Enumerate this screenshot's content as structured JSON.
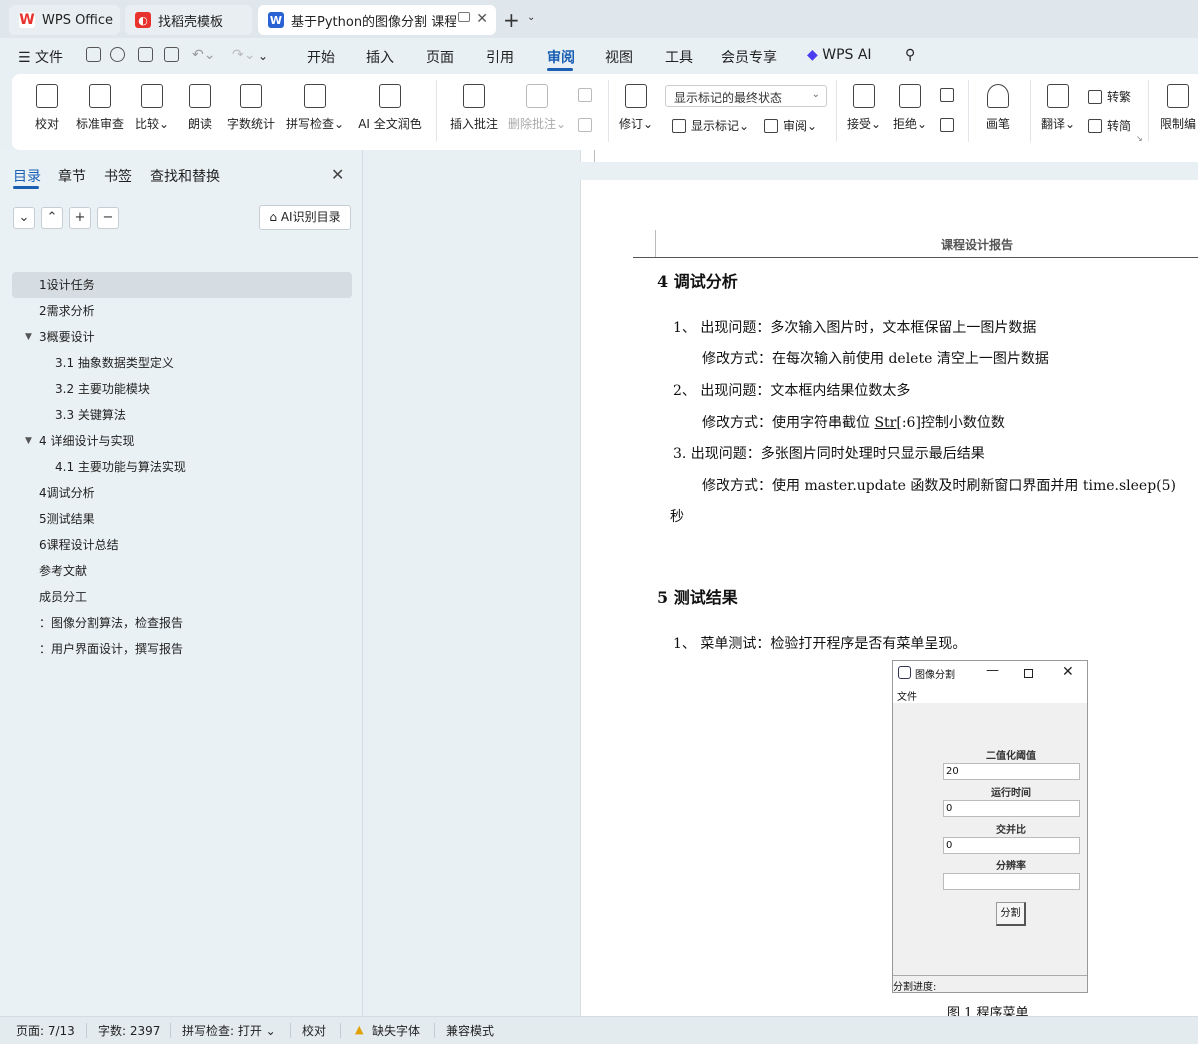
{
  "tabs": [
    {
      "label": "WPS Office",
      "icon": "wps-logo-icon",
      "color": "#e8322d"
    },
    {
      "label": "找稻壳模板",
      "icon": "docer-icon",
      "color": "#e8322d"
    },
    {
      "label": "基于Python的图像分割 课程",
      "icon": "writer-icon",
      "color": "#2a62d6"
    }
  ],
  "menu": {
    "file": "文件",
    "items": [
      "开始",
      "插入",
      "页面",
      "引用",
      "审阅",
      "视图",
      "工具",
      "会员专享"
    ],
    "active": "审阅",
    "wps_ai": "WPS AI"
  },
  "ribbon": {
    "proofread": "校对",
    "standard_review": "标准审查",
    "compare": "比较",
    "read_aloud": "朗读",
    "word_count": "字数统计",
    "spell_check": "拼写检查",
    "ai_polish": "AI 全文润色",
    "insert_comment": "插入批注",
    "delete_comment": "删除批注",
    "track_changes": "修订",
    "markup_select": "显示标记的最终状态",
    "show_markup": "显示标记",
    "review": "审阅",
    "accept": "接受",
    "reject": "拒绝",
    "pen": "画笔",
    "translate": "翻译",
    "to_traditional": "转繁",
    "to_simplified": "转简",
    "restrict_edit": "限制编"
  },
  "nav": {
    "tabs": [
      "目录",
      "章节",
      "书签",
      "查找和替换"
    ],
    "active_tab": "目录",
    "ai_toc": "AI识别目录",
    "toc": [
      {
        "label": "1设计任务",
        "level": 1,
        "active": true
      },
      {
        "label": "2需求分析",
        "level": 1
      },
      {
        "label": "3概要设计",
        "level": 1,
        "expanded": true
      },
      {
        "label": "3.1 抽象数据类型定义",
        "level": 2
      },
      {
        "label": "3.2  主要功能模块",
        "level": 2
      },
      {
        "label": "3.3  关键算法",
        "level": 2
      },
      {
        "label": "4    详细设计与实现",
        "level": 1,
        "expanded": true
      },
      {
        "label": "4.1  主要功能与算法实现",
        "level": 2
      },
      {
        "label": "4调试分析",
        "level": 1
      },
      {
        "label": "5测试结果",
        "level": 1
      },
      {
        "label": "6课程设计总结",
        "level": 1
      },
      {
        "label": "参考文献",
        "level": 1
      },
      {
        "label": "成员分工",
        "level": 1
      },
      {
        "label": "：图像分割算法，检查报告",
        "level": 1
      },
      {
        "label": "：用户界面设计，撰写报告",
        "level": 1
      }
    ]
  },
  "doc": {
    "running_header": "课程设计报告",
    "section4_title": "4   调试分析",
    "p1": "1、  出现问题：多次输入图片时，文本框保留上一图片数据",
    "p2": "修改方式：在每次输入前使用 delete 清空上一图片数据",
    "p3": "2、  出现问题：文本框内结果位数太多",
    "p4_a": "修改方式：使用字符串截位 ",
    "p4_u": "Str",
    "p4_b": "[:6]控制小数位数",
    "p5": "3.    出现问题：多张图片同时处理时只显示最后结果",
    "p6": "修改方式：使用 master.update  函数及时刷新窗口界面并用 time.sleep(5)",
    "p7": "秒",
    "section5_title": "5   测试结果",
    "p8": "1、  菜单测试：检验打开程序是否有菜单呈现。",
    "caption": "图 1  程序菜单"
  },
  "app": {
    "title": "图像分割",
    "menu_file": "文件",
    "fields": [
      {
        "label": "二值化阈值",
        "value": "20"
      },
      {
        "label": "运行时间",
        "value": "0"
      },
      {
        "label": "交并比",
        "value": "0"
      },
      {
        "label": "分辨率",
        "value": ""
      }
    ],
    "button": "分割",
    "status": "分割进度:"
  },
  "status": {
    "page": "页面: 7/13",
    "words": "字数: 2397",
    "spell": "拼写检查: 打开",
    "proof": "校对",
    "missing_font": "缺失字体",
    "compat": "兼容模式"
  }
}
